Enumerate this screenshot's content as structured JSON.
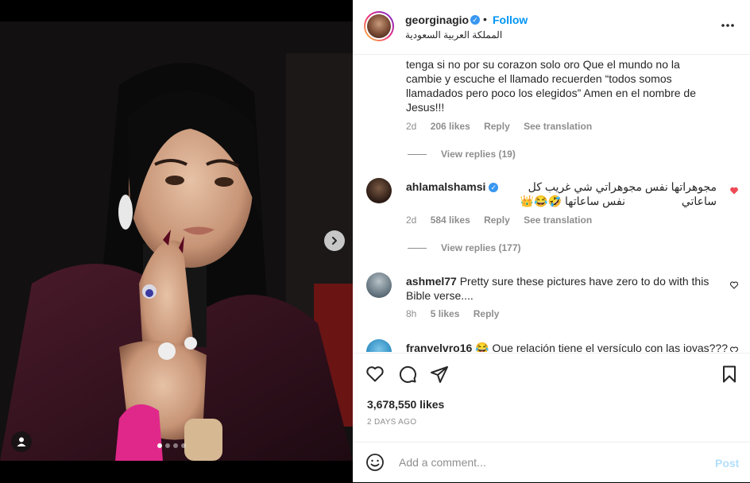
{
  "post": {
    "username": "georginagio",
    "separator": "•",
    "follow_label": "Follow",
    "location": "المملكة العربية السعودية",
    "carousel": {
      "total": 4,
      "active_index": 0
    }
  },
  "comments": [
    {
      "text_lines": [
        "tenga si no por su corazon solo oro Que el mundo no la",
        "cambie y escuche el llamado recuerden “todos somos",
        "llamadados pero poco los elegidos” Amen en el nombre de",
        "Jesus!!!"
      ],
      "time": "2d",
      "likes": "206 likes",
      "reply": "Reply",
      "translate": "See translation",
      "view_replies": "View replies (19)"
    },
    {
      "username": "ahlamalshamsi",
      "text_line1": "مجوهراتها نفس مجوهراتي شي غريب كل ساعاتي",
      "text_line2": "نفس ساعاتها 🤣😂👑",
      "time": "2d",
      "likes": "584 likes",
      "reply": "Reply",
      "translate": "See translation",
      "view_replies": "View replies (177)",
      "liked": true
    },
    {
      "username": "ashmel77",
      "text_line1": "Pretty sure these pictures have zero to do with this",
      "text_line2": "Bible verse....",
      "time": "8h",
      "likes": "5 likes",
      "reply": "Reply"
    },
    {
      "username": "franvelvro16",
      "text": "😂 Que relación tiene el versículo con las joyas???"
    }
  ],
  "stats": {
    "likes": "3,678,550 likes",
    "date": "2 DAYS AGO"
  },
  "add_comment": {
    "placeholder": "Add a comment...",
    "post_label": "Post"
  },
  "colors": {
    "accent": "#0095f6",
    "liked_heart": "#ed4956",
    "verified": "#3897f0"
  }
}
